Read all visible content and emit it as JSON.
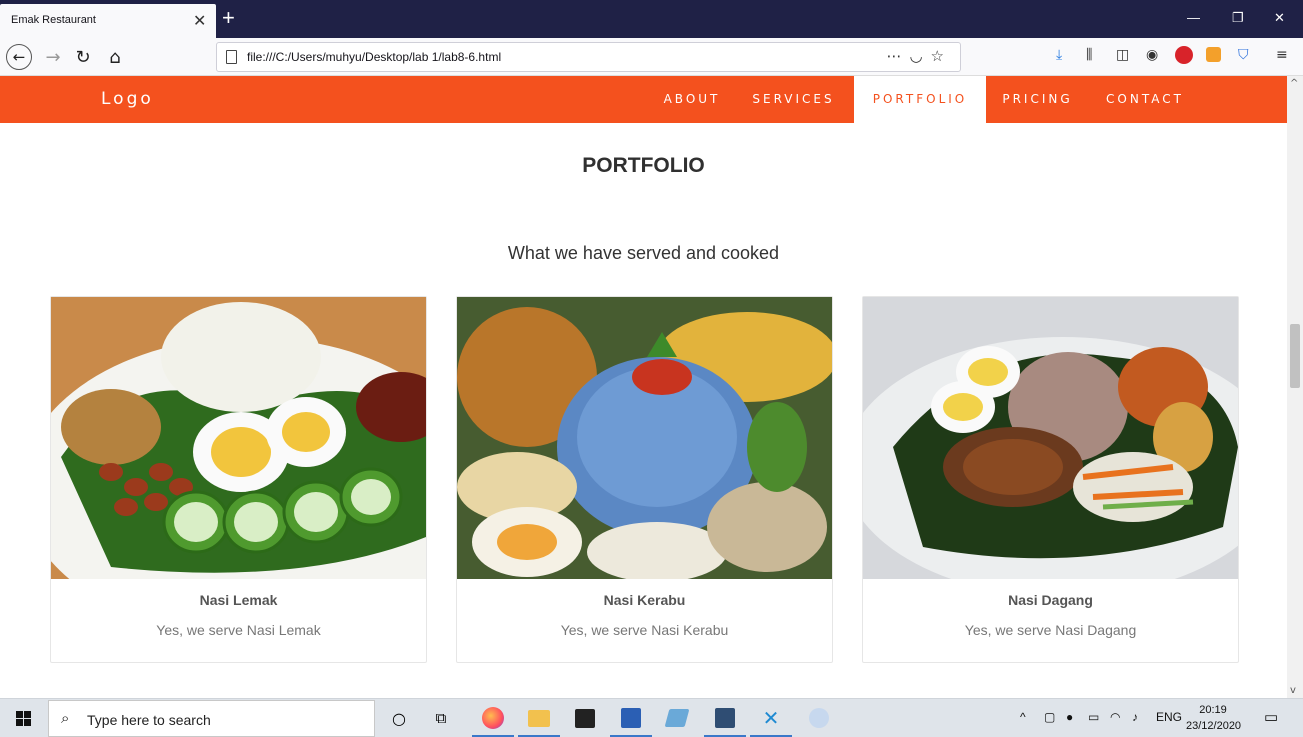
{
  "browser": {
    "tab_title": "Emak Restaurant",
    "tab_close": "✕",
    "new_tab": "+",
    "url": "file:///C:/Users/muhyu/Desktop/lab 1/lab8-6.html",
    "window_controls": [
      "—",
      "❐",
      "✕"
    ],
    "icons": [
      "back-icon",
      "forward-icon",
      "reload-icon",
      "home-icon",
      "more-icon",
      "pocket-icon",
      "bookmark-star-icon",
      "download-icon",
      "library-icon",
      "sidebar-icon",
      "account-icon",
      "adblock-icon",
      "extension-icon",
      "shield-icon",
      "menu-icon"
    ]
  },
  "site": {
    "logo": "Logo",
    "nav": [
      {
        "label": "ABOUT"
      },
      {
        "label": "SERVICES"
      },
      {
        "label": "PORTFOLIO",
        "active": true
      },
      {
        "label": "PRICING"
      },
      {
        "label": "CONTACT"
      }
    ],
    "accent_color": "#f4511e",
    "heading": "PORTFOLIO",
    "subheading": "What we have served and cooked",
    "cards": [
      {
        "title": "Nasi Lemak",
        "text": "Yes, we serve Nasi Lemak"
      },
      {
        "title": "Nasi Kerabu",
        "text": "Yes, we serve Nasi Kerabu"
      },
      {
        "title": "Nasi Dagang",
        "text": "Yes, we serve Nasi Dagang"
      }
    ]
  },
  "taskbar": {
    "search_placeholder": "Type here to search",
    "language": "ENG",
    "time": "20:19",
    "date": "23/12/2020",
    "icons": [
      "cortana-icon",
      "task-view-icon",
      "firefox-icon",
      "file-explorer-icon",
      "store-icon",
      "word-icon",
      "app-icon",
      "app2-icon",
      "vscode-icon",
      "paint-icon"
    ]
  }
}
